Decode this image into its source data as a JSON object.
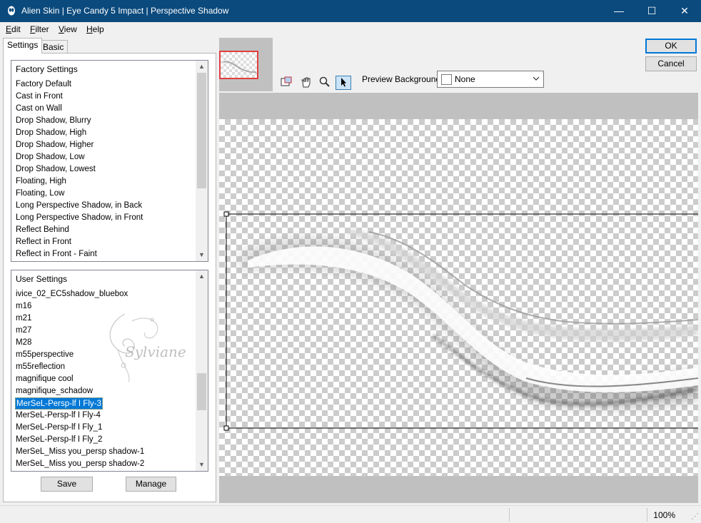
{
  "window": {
    "title": "Alien Skin | Eye Candy 5 Impact | Perspective Shadow",
    "controls": {
      "minimize": "—",
      "maximize": "☐",
      "close": "✕"
    }
  },
  "menu": {
    "items": [
      {
        "key": "E",
        "rest": "dit"
      },
      {
        "key": "F",
        "rest": "ilter"
      },
      {
        "key": "V",
        "rest": "iew"
      },
      {
        "key": "H",
        "rest": "elp"
      }
    ]
  },
  "tabs": {
    "settings": "Settings",
    "basic": "Basic"
  },
  "factory_settings": {
    "header": "Factory Settings",
    "items": [
      "Factory Default",
      "Cast in Front",
      "Cast on Wall",
      "Drop Shadow, Blurry",
      "Drop Shadow, High",
      "Drop Shadow, Higher",
      "Drop Shadow, Low",
      "Drop Shadow, Lowest",
      "Floating, High",
      "Floating, Low",
      "Long Perspective Shadow, in Back",
      "Long Perspective Shadow, in Front",
      "Reflect Behind",
      "Reflect in Front",
      "Reflect in Front - Faint"
    ]
  },
  "user_settings": {
    "header": "User Settings",
    "items": [
      "ivice_02_EC5shadow_bluebox",
      "m16",
      "m21",
      "m27",
      "M28",
      "m55perspective",
      "m55reflection",
      "magnifique cool",
      "magnifique_schadow",
      "MerSeL-Persp-lf I Fly-3",
      "MerSeL-Persp-lf I Fly-4",
      "MerSeL-Persp-lf I Fly_1",
      "MerSeL-Persp-lf I Fly_2",
      "MerSeL_Miss you_persp shadow-1",
      "MerSeL_Miss you_persp shadow-2"
    ],
    "selected_index": 9
  },
  "buttons": {
    "save": "Save",
    "manage": "Manage",
    "ok": "OK",
    "cancel": "Cancel"
  },
  "toolbar": {
    "tools": [
      {
        "name": "navigator-icon",
        "glyph": "⊞"
      },
      {
        "name": "hand-pan-icon",
        "glyph": "✋"
      },
      {
        "name": "zoom-icon",
        "glyph": "🔍"
      },
      {
        "name": "pointer-select-icon",
        "glyph": "↖"
      }
    ],
    "active_tool": "pointer-select-icon"
  },
  "preview_background": {
    "label": "Preview Background:",
    "value": "None"
  },
  "watermark_text": "Sylviane",
  "status": {
    "zoom": "100%"
  },
  "colors": {
    "titlebar": "#0b4a7d",
    "selection": "#0078d7",
    "accent_border": "#0078d7",
    "thumb_frame": "#e04040"
  }
}
